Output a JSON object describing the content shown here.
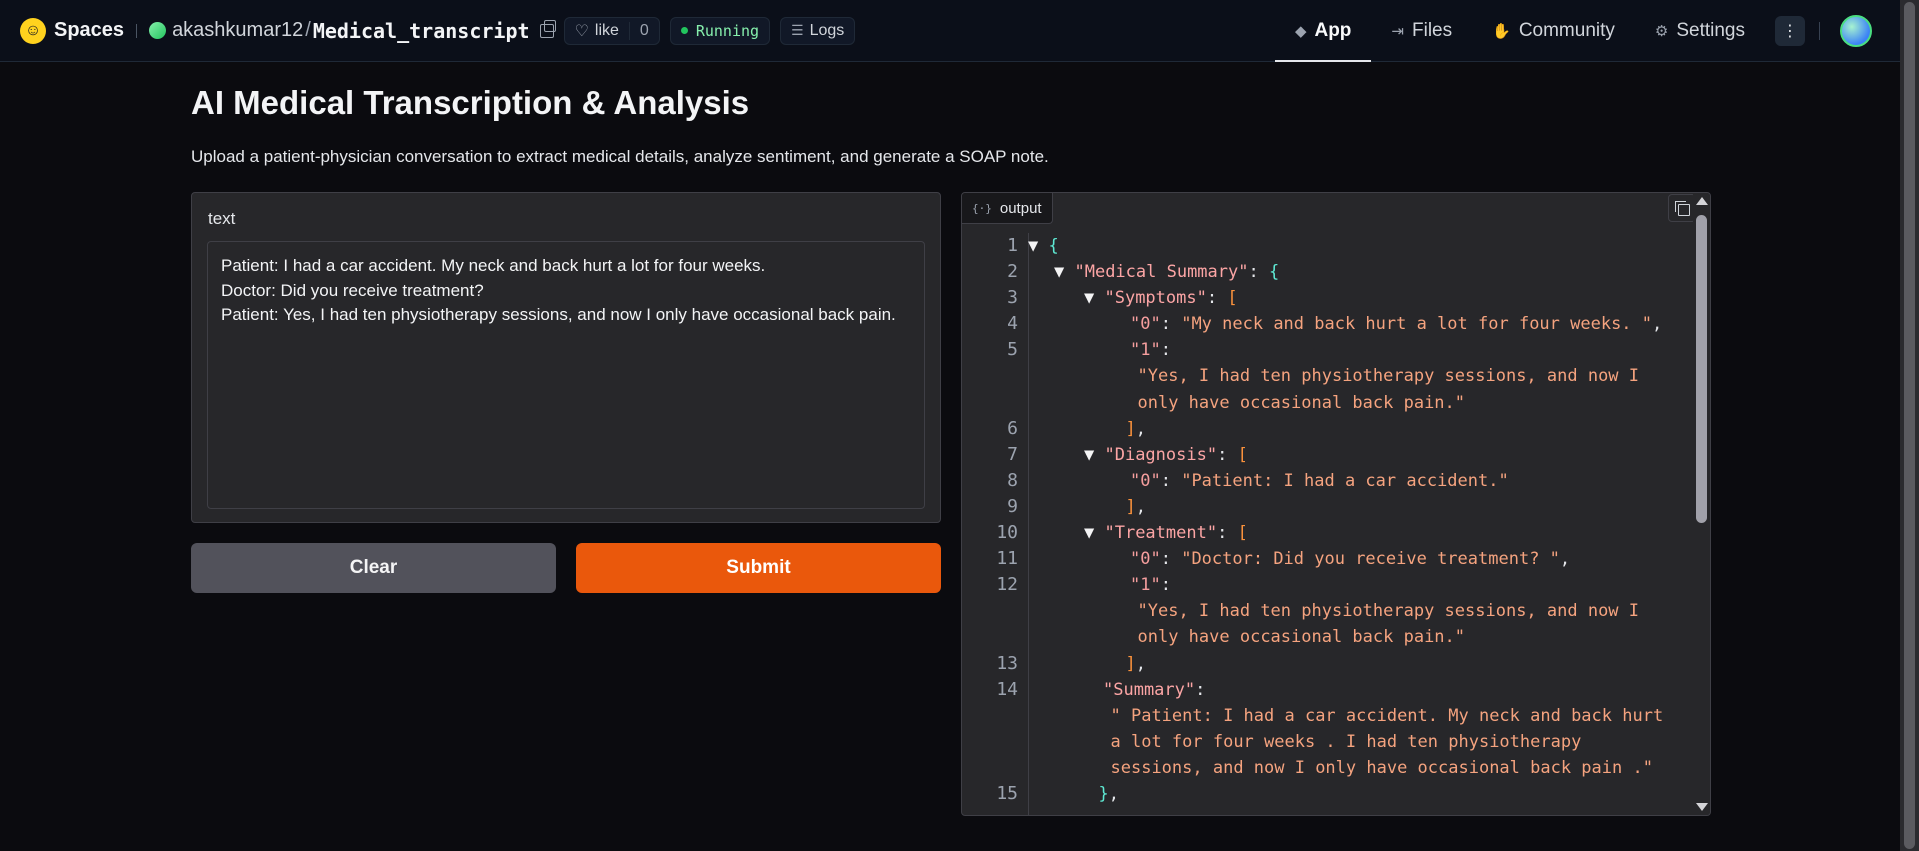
{
  "nav": {
    "brand": "Spaces",
    "owner": "akashkumar12",
    "separator": "/",
    "repo": "Medical_transcript",
    "like_label": "like",
    "like_count": "0",
    "status": "Running",
    "logs": "Logs",
    "tabs": [
      {
        "label": "App",
        "icon": "cube-icon",
        "active": true
      },
      {
        "label": "Files",
        "icon": "files-icon",
        "active": false
      },
      {
        "label": "Community",
        "icon": "community-icon",
        "active": false
      },
      {
        "label": "Settings",
        "icon": "gear-icon",
        "active": false
      }
    ]
  },
  "page": {
    "title": "AI Medical Transcription & Analysis",
    "description": "Upload a patient-physician conversation to extract medical details, analyze sentiment, and generate a SOAP note."
  },
  "input": {
    "label": "text",
    "value": "Patient: I had a car accident. My neck and back hurt a lot for four weeks.\nDoctor: Did you receive treatment?\nPatient: Yes, I had ten physiotherapy sessions, and now I only have occasional back pain."
  },
  "buttons": {
    "clear": "Clear",
    "submit": "Submit"
  },
  "output": {
    "label": "output",
    "tab_icon": "{·}",
    "lines": [
      {
        "num": "1",
        "indent": 0,
        "tri": true,
        "parts": [
          {
            "c": "brace",
            "t": "{"
          }
        ]
      },
      {
        "num": "2",
        "indent": 1,
        "tri": true,
        "parts": [
          {
            "c": "key",
            "t": "\"Medical Summary\""
          },
          {
            "c": "punct",
            "t": ": "
          },
          {
            "c": "brace",
            "t": "{"
          }
        ]
      },
      {
        "num": "3",
        "indent": 2,
        "tri": true,
        "parts": [
          {
            "c": "key",
            "t": "\"Symptoms\""
          },
          {
            "c": "punct",
            "t": ": "
          },
          {
            "c": "bracket",
            "t": "["
          }
        ]
      },
      {
        "num": "4",
        "indent": 3,
        "tri": false,
        "parts": [
          {
            "c": "key2",
            "t": "\"0\""
          },
          {
            "c": "punct",
            "t": ": "
          },
          {
            "c": "str",
            "t": "\"My neck and back hurt a lot for four weeks. \""
          },
          {
            "c": "punct",
            "t": ","
          }
        ]
      },
      {
        "num": "5",
        "indent": 3,
        "tri": false,
        "parts": [
          {
            "c": "key2",
            "t": "\"1\""
          },
          {
            "c": "punct",
            "t": ":"
          }
        ]
      },
      {
        "num": "",
        "indent": 3.25,
        "tri": false,
        "parts": [
          {
            "c": "str",
            "t": "\"Yes, I had ten physiotherapy sessions, and now I"
          }
        ]
      },
      {
        "num": "",
        "indent": 3.25,
        "tri": false,
        "parts": [
          {
            "c": "str",
            "t": "only have occasional back pain.\""
          }
        ]
      },
      {
        "num": "6",
        "indent": 2.85,
        "tri": false,
        "parts": [
          {
            "c": "bracket",
            "t": "]"
          },
          {
            "c": "punct",
            "t": ","
          }
        ]
      },
      {
        "num": "7",
        "indent": 2,
        "tri": true,
        "parts": [
          {
            "c": "key",
            "t": "\"Diagnosis\""
          },
          {
            "c": "punct",
            "t": ": "
          },
          {
            "c": "bracket",
            "t": "["
          }
        ]
      },
      {
        "num": "8",
        "indent": 3,
        "tri": false,
        "parts": [
          {
            "c": "key2",
            "t": "\"0\""
          },
          {
            "c": "punct",
            "t": ": "
          },
          {
            "c": "str",
            "t": "\"Patient: I had a car accident.\""
          }
        ]
      },
      {
        "num": "9",
        "indent": 2.85,
        "tri": false,
        "parts": [
          {
            "c": "bracket",
            "t": "]"
          },
          {
            "c": "punct",
            "t": ","
          }
        ]
      },
      {
        "num": "10",
        "indent": 2,
        "tri": true,
        "parts": [
          {
            "c": "key",
            "t": "\"Treatment\""
          },
          {
            "c": "punct",
            "t": ": "
          },
          {
            "c": "bracket",
            "t": "["
          }
        ]
      },
      {
        "num": "11",
        "indent": 3,
        "tri": false,
        "parts": [
          {
            "c": "key2",
            "t": "\"0\""
          },
          {
            "c": "punct",
            "t": ": "
          },
          {
            "c": "str",
            "t": "\"Doctor: Did you receive treatment? \""
          },
          {
            "c": "punct",
            "t": ","
          }
        ]
      },
      {
        "num": "12",
        "indent": 3,
        "tri": false,
        "parts": [
          {
            "c": "key2",
            "t": "\"1\""
          },
          {
            "c": "punct",
            "t": ":"
          }
        ]
      },
      {
        "num": "",
        "indent": 3.25,
        "tri": false,
        "parts": [
          {
            "c": "str",
            "t": "\"Yes, I had ten physiotherapy sessions, and now I"
          }
        ]
      },
      {
        "num": "",
        "indent": 3.25,
        "tri": false,
        "parts": [
          {
            "c": "str",
            "t": "only have occasional back pain.\""
          }
        ]
      },
      {
        "num": "13",
        "indent": 2.85,
        "tri": false,
        "parts": [
          {
            "c": "bracket",
            "t": "]"
          },
          {
            "c": "punct",
            "t": ","
          }
        ]
      },
      {
        "num": "14",
        "indent": 2.1,
        "tri": false,
        "parts": [
          {
            "c": "key",
            "t": "\"Summary\""
          },
          {
            "c": "punct",
            "t": ":"
          }
        ]
      },
      {
        "num": "",
        "indent": 2.35,
        "tri": false,
        "parts": [
          {
            "c": "str",
            "t": "\" Patient: I had a car accident. My neck and back hurt"
          }
        ]
      },
      {
        "num": "",
        "indent": 2.35,
        "tri": false,
        "parts": [
          {
            "c": "str",
            "t": "a lot for four weeks . I had ten physiotherapy"
          }
        ]
      },
      {
        "num": "",
        "indent": 2.35,
        "tri": false,
        "parts": [
          {
            "c": "str",
            "t": "sessions, and now I only have occasional back pain .\""
          }
        ]
      },
      {
        "num": "15",
        "indent": 1.95,
        "tri": false,
        "parts": [
          {
            "c": "brace",
            "t": "}"
          },
          {
            "c": "punct",
            "t": ","
          }
        ]
      }
    ]
  },
  "colors": {
    "accent": "#ea580c",
    "status_green": "#22c55e"
  }
}
